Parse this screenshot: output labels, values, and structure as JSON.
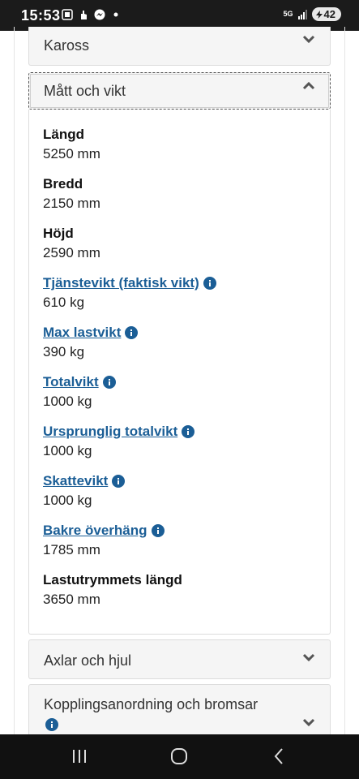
{
  "status_bar": {
    "time": "15:53",
    "network": "5G",
    "battery": "42"
  },
  "sections": {
    "kaross": "Kaross",
    "matt_och_vikt": "Mått och vikt",
    "axlar_och_hjul": "Axlar och hjul",
    "kopplingsanordning": "Kopplingsanordning och bromsar"
  },
  "specs": [
    {
      "label": "Längd",
      "value": "5250 mm",
      "link": false
    },
    {
      "label": "Bredd",
      "value": "2150 mm",
      "link": false
    },
    {
      "label": "Höjd",
      "value": "2590 mm",
      "link": false
    },
    {
      "label": "Tjänstevikt (faktisk vikt)",
      "value": "610 kg",
      "link": true
    },
    {
      "label": "Max lastvikt",
      "value": "390 kg",
      "link": true
    },
    {
      "label": "Totalvikt",
      "value": "1000 kg",
      "link": true
    },
    {
      "label": "Ursprunglig totalvikt",
      "value": "1000 kg",
      "link": true
    },
    {
      "label": "Skattevikt",
      "value": "1000 kg",
      "link": true
    },
    {
      "label": "Bakre överhäng",
      "value": "1785 mm",
      "link": true
    },
    {
      "label": "Lastutrymmets längd",
      "value": "3650 mm",
      "link": false
    }
  ],
  "colors": {
    "link": "#1b5e96",
    "info_icon": "#1b5e96",
    "panel_header_bg": "#f5f5f5"
  },
  "icons": {
    "chevron_collapsed": "chevron-down-icon",
    "chevron_expanded": "chevron-up-icon",
    "info": "info-icon"
  }
}
